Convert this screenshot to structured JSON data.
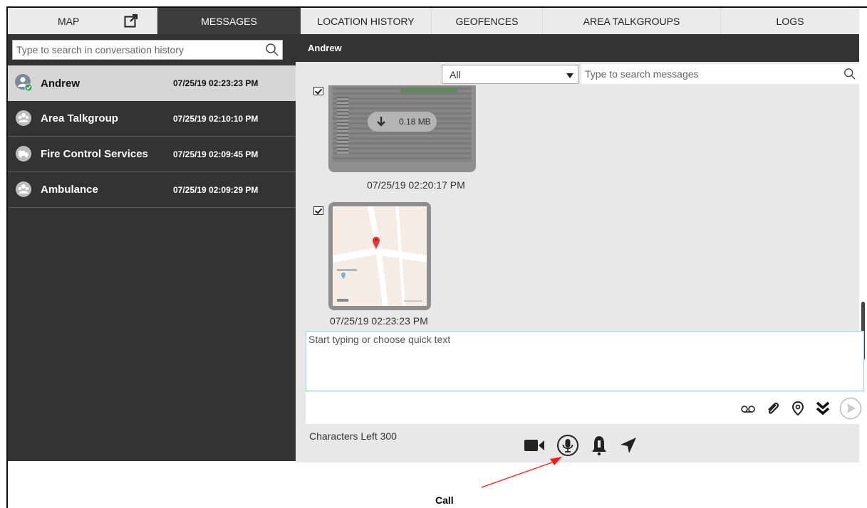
{
  "tabs": [
    {
      "label": "MAP"
    },
    {
      "label": "MESSAGES"
    },
    {
      "label": "LOCATION HISTORY"
    },
    {
      "label": "GEOFENCES"
    },
    {
      "label": "AREA TALKGROUPS"
    },
    {
      "label": "LOGS"
    }
  ],
  "conversation_search": {
    "placeholder": "Type to search in conversation history"
  },
  "conversations": [
    {
      "name": "Andrew",
      "time": "07/25/19 02:23:23 PM",
      "icon": "user-online-icon"
    },
    {
      "name": "Area Talkgroup",
      "time": "07/25/19 02:10:10 PM",
      "icon": "group-icon"
    },
    {
      "name": "Fire Control Services",
      "time": "07/25/19 02:09:45 PM",
      "icon": "truck-icon"
    },
    {
      "name": "Ambulance",
      "time": "07/25/19 02:09:29 PM",
      "icon": "group-icon"
    }
  ],
  "thread": {
    "title": "Andrew",
    "filter_value": "All",
    "search_placeholder": "Type to search messages",
    "messages": [
      {
        "type": "image-attachment",
        "size": "0.18 MB",
        "time": "07/25/19 02:20:17 PM"
      },
      {
        "type": "location",
        "time": "07/25/19 02:23:23 PM"
      }
    ]
  },
  "compose": {
    "placeholder": "Start typing or choose quick text",
    "characters_left": "Characters Left 300"
  },
  "annotation": {
    "label": "Call"
  },
  "colors": {
    "dark_panel": "#333333",
    "selected_row": "#d6d6d6",
    "accent_border": "#8fcfe8",
    "callout_arrow": "#ff0000"
  }
}
